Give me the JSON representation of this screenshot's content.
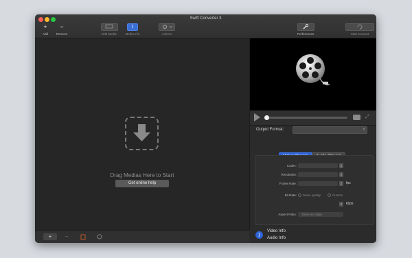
{
  "window": {
    "title": "Swift Converter 3"
  },
  "toolbar": {
    "add": {
      "icon": "+",
      "label": "Add"
    },
    "remove": {
      "icon": "−",
      "label": "Remove"
    },
    "edit_media": {
      "label": "Edit Media"
    },
    "media_info": {
      "icon": "i",
      "label": "Media Info"
    },
    "actions": {
      "label": "Actions"
    },
    "preferences": {
      "label": "Preferences"
    },
    "start_convert": {
      "label": "Start Convert"
    }
  },
  "dropzone": {
    "message": "Drag Medias Here to Start",
    "help_button": "Get online help"
  },
  "bottom_bar": {
    "add": "+",
    "remove": "−"
  },
  "player": {
    "progress": 0
  },
  "settings": {
    "output_format_label": "Output Format:",
    "tabs": [
      "Video Stream",
      "Audio Stream"
    ],
    "active_tab": "Video Stream",
    "codec_label": "Codec:",
    "resolution_label": "Resolution:",
    "frame_rate_label": "Frame Rate:",
    "frame_rate_unit": "fps",
    "bit_rate_label": "Bit Rate:",
    "bit_rate_option1": "Same quality",
    "bit_rate_option2": "Custom",
    "bit_rate_unit": "kbps",
    "aspect_ratio_label": "Aspect Ratio:",
    "aspect_ratio_value": "Same as origin"
  },
  "info": {
    "video_info": "Video Info",
    "audio_info": "Audio Info"
  },
  "colors": {
    "accent": "#2f63d8",
    "window_bg": "#2b2b2b"
  }
}
